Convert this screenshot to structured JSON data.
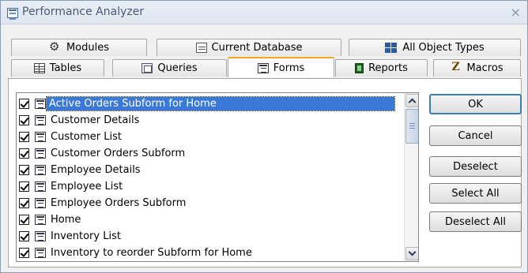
{
  "window": {
    "title": "Performance Analyzer",
    "close_glyph": "×"
  },
  "tabs_row1": [
    {
      "label": "Modules",
      "icon": "modules-icon"
    },
    {
      "label": "Current Database",
      "icon": "database-icon"
    },
    {
      "label": "All Object Types",
      "icon": "all-objects-icon"
    }
  ],
  "tabs_row2": [
    {
      "label": "Tables",
      "icon": "table-icon"
    },
    {
      "label": "Queries",
      "icon": "query-icon"
    },
    {
      "label": "Forms",
      "icon": "form-icon",
      "active": true
    },
    {
      "label": "Reports",
      "icon": "report-icon"
    },
    {
      "label": "Macros",
      "icon": "macro-icon"
    }
  ],
  "forms_list": [
    {
      "label": "Active Orders Subform for Home",
      "checked": true,
      "selected": true
    },
    {
      "label": "Customer Details",
      "checked": true
    },
    {
      "label": "Customer List",
      "checked": true
    },
    {
      "label": "Customer Orders Subform",
      "checked": true
    },
    {
      "label": "Employee Details",
      "checked": true
    },
    {
      "label": "Employee List",
      "checked": true
    },
    {
      "label": "Employee Orders Subform",
      "checked": true
    },
    {
      "label": "Home",
      "checked": true
    },
    {
      "label": "Inventory List",
      "checked": true
    },
    {
      "label": "Inventory to reorder Subform for Home",
      "checked": true
    }
  ],
  "buttons": {
    "ok": "OK",
    "cancel": "Cancel",
    "deselect": "Deselect",
    "select_all": "Select All",
    "deselect_all": "Deselect All"
  },
  "colors": {
    "active_tab_accent": "#f5a623",
    "selection": "#3a79d8"
  }
}
